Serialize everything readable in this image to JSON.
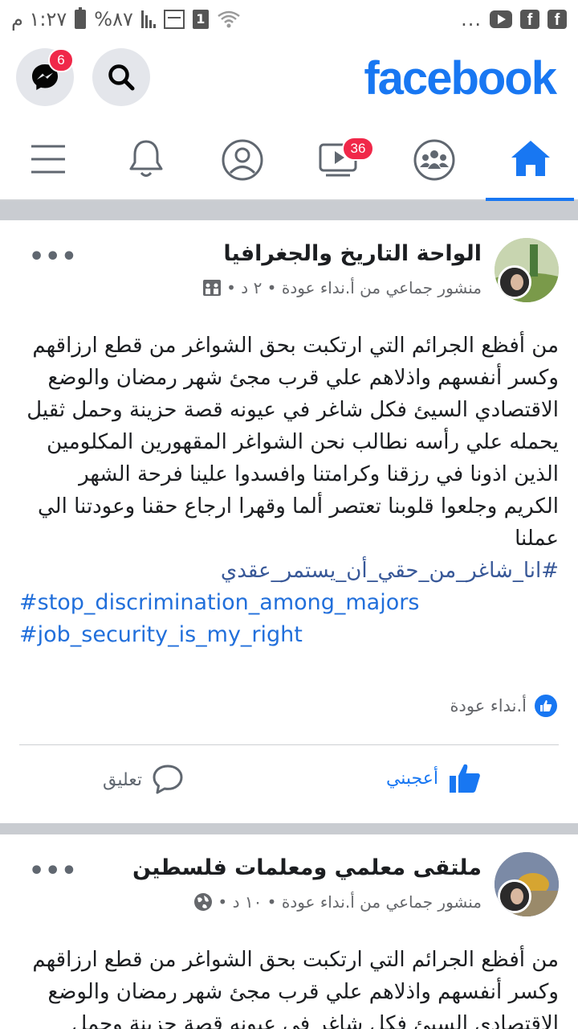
{
  "status_bar": {
    "time": "١:٢٧ م",
    "battery": "%٨٧",
    "sim": "1",
    "overflow": "..."
  },
  "header": {
    "logo": "facebook",
    "messenger_badge": "6"
  },
  "nav": {
    "video_badge": "36"
  },
  "posts": [
    {
      "group_name": "الواحة التاريخ والجغرافيا",
      "meta": "منشور جماعي من أ.نداء عودة • ٢ د •",
      "more": "•••",
      "text": "من أفظع الجرائم التي ارتكبت بحق الشواغر من قطع ارزاقهم وكسر أنفسهم واذلاهم علي قرب مجئ شهر رمضان والوضع الاقتصادي السيئ فكل شاغر في عيونه قصة حزينة وحمل ثقيل يحمله علي رأسه نطالب نحن الشواغر المقهورين المكلومين الذين اذونا في رزقنا وكرامتنا وافسدوا علينا فرحة الشهر الكريم وجلعوا قلوبنا تعتصر ألما وقهرا ارجاع حقنا وعودتنا الي عملنا",
      "hashtags_ar": [
        "#انا_شاغر_من_حقي_أن_يستمر_عقدي"
      ],
      "hashtags_en": [
        "#stop_discrimination_among_majors",
        "#job_security_is_my_right"
      ],
      "reaction_name": "أ.نداء عودة",
      "like_label": "أعجبني",
      "comment_label": "تعليق"
    },
    {
      "group_name": "ملتقى معلمي ومعلمات فلسطين",
      "meta": "منشور جماعي من أ.نداء عودة • ١٠ د •",
      "more": "•••",
      "text": "من أفظع الجرائم التي ارتكبت بحق الشواغر من قطع ارزاقهم وكسر أنفسهم واذلاهم علي قرب مجئ شهر رمضان والوضع الاقتصادي السيئ فكل شاغر في عيونه قصة حزينة وحمل"
    }
  ],
  "colors": {
    "brand": "#1877f2",
    "badge": "#f02849",
    "divider": "#c9ccd1"
  },
  "icons": {
    "header": [
      "messenger-icon",
      "search-icon"
    ],
    "nav": [
      "home-icon",
      "groups-icon",
      "video-icon",
      "profile-icon",
      "bell-icon",
      "menu-icon"
    ]
  }
}
